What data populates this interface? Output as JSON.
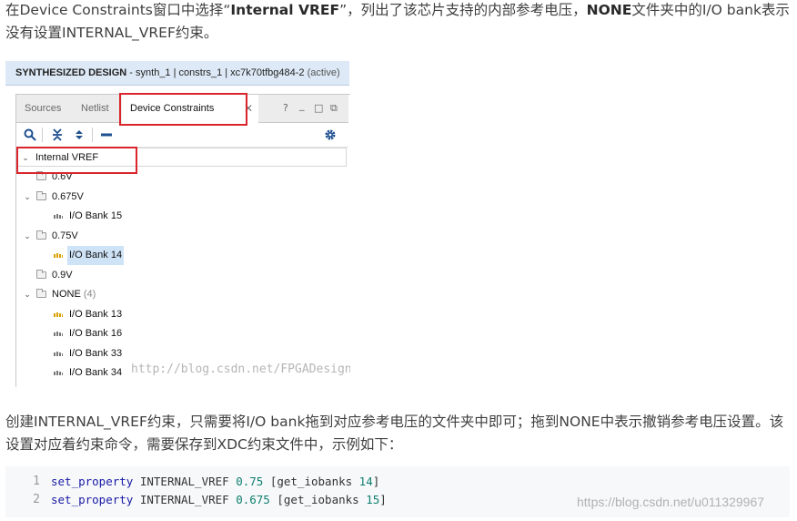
{
  "article": {
    "p1_pre": "在Device Constraints窗口中选择“",
    "p1_bold1": "Internal VREF",
    "p1_mid": "”，列出了该芯片支持的内部参考电压，",
    "p1_bold2": "NONE",
    "p1_post": "文件夹中的I/O bank表示没有设置INTERNAL_VREF约束。",
    "p2": "创建INTERNAL_VREF约束，只需要将I/O bank拖到对应参考电压的文件夹中即可；拖到NONE中表示撤销参考电压设置。该设置对应着约束命令，需要保存到XDC约束文件中，示例如下："
  },
  "screenshot": {
    "title_strong": "SYNTHESIZED DESIGN",
    "title_rest": " - synth_1 | constrs_1 | xc7k70tfbg484-2 ",
    "title_active": "(active)",
    "tabs": [
      "Sources",
      "Netlist",
      "Device Constraints"
    ],
    "window_controls": [
      "?",
      "_",
      "□",
      "⧉"
    ],
    "tree": {
      "root": "Internal VREF",
      "items": [
        {
          "label": "0.6V",
          "kind": "folder"
        },
        {
          "label": "0.675V",
          "kind": "folder"
        },
        {
          "label": "I/O Bank 15",
          "kind": "bank"
        },
        {
          "label": "0.75V",
          "kind": "folder"
        },
        {
          "label": "I/O Bank 14",
          "kind": "bank"
        },
        {
          "label": "0.9V",
          "kind": "folder"
        },
        {
          "label": "NONE",
          "kind": "folder",
          "count": "(4)"
        },
        {
          "label": "I/O Bank 13",
          "kind": "bank"
        },
        {
          "label": "I/O Bank 16",
          "kind": "bank"
        },
        {
          "label": "I/O Bank 33",
          "kind": "bank"
        },
        {
          "label": "I/O Bank 34",
          "kind": "bank"
        }
      ]
    },
    "watermark": "http://blog.csdn.net/FPGADesigner"
  },
  "code": {
    "lines": [
      {
        "n": "1",
        "cmd": "set_property",
        "prop": " INTERNAL_VREF ",
        "val": "0.75",
        "obj": " [get_iobanks ",
        "bank": "14",
        "end": "]"
      },
      {
        "n": "2",
        "cmd": "set_property",
        "prop": " INTERNAL_VREF ",
        "val": "0.675",
        "obj": " [get_iobanks ",
        "bank": "15",
        "end": "]"
      }
    ]
  },
  "watermark": "https://blog.csdn.net/u011329967",
  "colors": {
    "highlight_red": "#d9252b",
    "titlebar": "#dde9f6",
    "selection": "#cfe3f7",
    "bank_icon": "#d9a000"
  }
}
